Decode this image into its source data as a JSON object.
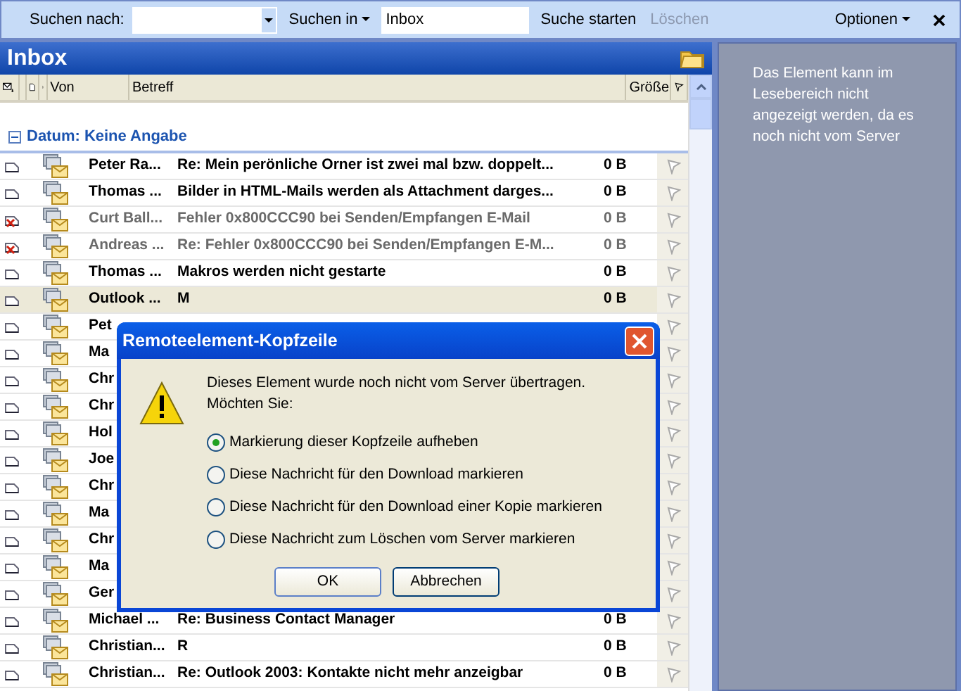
{
  "search_bar": {
    "label": "Suchen nach:",
    "scope_button": "Suchen in",
    "scope_value": "Inbox",
    "start_button": "Suche starten",
    "clear_button": {
      "label": "Löschen",
      "disabled": true
    },
    "options_button": "Optionen"
  },
  "folder": {
    "title": "Inbox"
  },
  "columns": [
    "Von",
    "Betreff",
    "Größe"
  ],
  "group": {
    "label": "Datum: Keine Angabe",
    "expanded": true
  },
  "messages": [
    {
      "sender": "Peter Ra...",
      "subject": "Re: Mein perönliche Orner ist zwei mal bzw. doppelt...",
      "size": "0 B",
      "deleted": false,
      "selected": false
    },
    {
      "sender": "Thomas ...",
      "subject": "Bilder in HTML-Mails werden als Attachment darges...",
      "size": "0 B",
      "deleted": false,
      "selected": false
    },
    {
      "sender": "Curt Ball...",
      "subject": "Fehler 0x800CCC90 bei Senden/Empfangen E-Mail",
      "size": "0 B",
      "deleted": true,
      "selected": false
    },
    {
      "sender": "Andreas ...",
      "subject": "Re: Fehler 0x800CCC90 bei Senden/Empfangen E-M...",
      "size": "0 B",
      "deleted": true,
      "selected": false
    },
    {
      "sender": "Thomas ...",
      "subject": "Makros werden nicht gestarte",
      "size": "0 B",
      "deleted": false,
      "selected": false
    },
    {
      "sender": "Outlook ...",
      "subject": "M",
      "size": "0 B",
      "deleted": false,
      "selected": true
    },
    {
      "sender": "Pet",
      "deleted": false,
      "selected": false
    },
    {
      "sender": "Ma",
      "deleted": false,
      "selected": false
    },
    {
      "sender": "Chr",
      "deleted": false,
      "selected": false
    },
    {
      "sender": "Chr",
      "deleted": false,
      "selected": false
    },
    {
      "sender": "Hol",
      "deleted": false,
      "selected": false
    },
    {
      "sender": "Joe",
      "deleted": false,
      "selected": false
    },
    {
      "sender": "Chr",
      "deleted": false,
      "selected": false
    },
    {
      "sender": "Ma",
      "deleted": false,
      "selected": false
    },
    {
      "sender": "Chr",
      "deleted": false,
      "selected": false
    },
    {
      "sender": "Ma",
      "deleted": false,
      "selected": false
    },
    {
      "sender": "Ger",
      "deleted": false,
      "selected": false
    },
    {
      "sender": "Michael ...",
      "subject": "Re: Business Contact Manager",
      "size": "0 B",
      "deleted": false,
      "selected": false
    },
    {
      "sender": "Christian...",
      "subject": "R",
      "size": "0 B",
      "deleted": false,
      "selected": false
    },
    {
      "sender": "Christian...",
      "subject": "Re: Outlook 2003: Kontakte nicht mehr anzeigbar",
      "size": "0 B",
      "deleted": false,
      "selected": false
    }
  ],
  "reading_pane": {
    "text": "Das Element kann im Lesebereich nicht angezeigt werden, da es noch nicht vom Server"
  },
  "dialog": {
    "title": "Remoteelement-Kopfzeile",
    "message_lines": [
      "Dieses Element wurde noch nicht vom Server übertragen.",
      "Möchten Sie:"
    ],
    "options": [
      {
        "label": "Markierung dieser Kopfzeile aufheben",
        "selected": true
      },
      {
        "label": "Diese Nachricht für den Download markieren",
        "selected": false
      },
      {
        "label": "Diese Nachricht für den Download einer Kopie markieren",
        "selected": false
      },
      {
        "label": "Diese Nachricht zum Löschen vom Server markieren",
        "selected": false
      }
    ],
    "buttons": [
      "OK",
      "Abbrechen"
    ]
  }
}
